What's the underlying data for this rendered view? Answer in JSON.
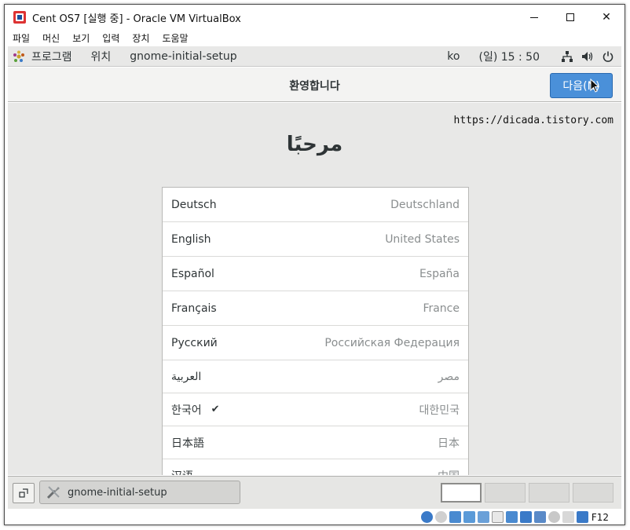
{
  "window": {
    "title": "Cent OS7 [실행 중] - Oracle VM VirtualBox",
    "close_glyph": "✕"
  },
  "menu": {
    "items": [
      {
        "label": "파일"
      },
      {
        "label": "머신"
      },
      {
        "label": "보기"
      },
      {
        "label": "입력"
      },
      {
        "label": "장치"
      },
      {
        "label": "도움말"
      }
    ]
  },
  "gnome_bar": {
    "programs_label": "프로그램",
    "places_label": "위치",
    "app_label": "gnome-initial-setup",
    "locale": "ko",
    "clock": "(일) 15 : 50",
    "icons": [
      "network-icon",
      "volume-icon",
      "power-icon"
    ]
  },
  "header": {
    "title": "환영합니다",
    "next_button": "다음(N)"
  },
  "content": {
    "watermark": "https://dicada.tistory.com",
    "welcome": "مرحبًا",
    "languages": [
      {
        "name": "Deutsch",
        "region": "Deutschland",
        "selected": false
      },
      {
        "name": "English",
        "region": "United States",
        "selected": false
      },
      {
        "name": "Español",
        "region": "España",
        "selected": false
      },
      {
        "name": "Français",
        "region": "France",
        "selected": false
      },
      {
        "name": "Русский",
        "region": "Российская Федерация",
        "selected": false
      },
      {
        "name": "العربية",
        "region": "مصر",
        "selected": false
      },
      {
        "name": "한국어",
        "region": "대한민국",
        "selected": true
      },
      {
        "name": "日本語",
        "region": "日本",
        "selected": false
      },
      {
        "name": "汉语",
        "region": "中国",
        "selected": false
      }
    ],
    "check_glyph": "✔"
  },
  "taskbar": {
    "task_label": "gnome-initial-setup",
    "workspaces": 4,
    "active_workspace": 1
  },
  "statusbar": {
    "host_key": "F12",
    "colors": {
      "accent": "#4a90d9"
    }
  }
}
